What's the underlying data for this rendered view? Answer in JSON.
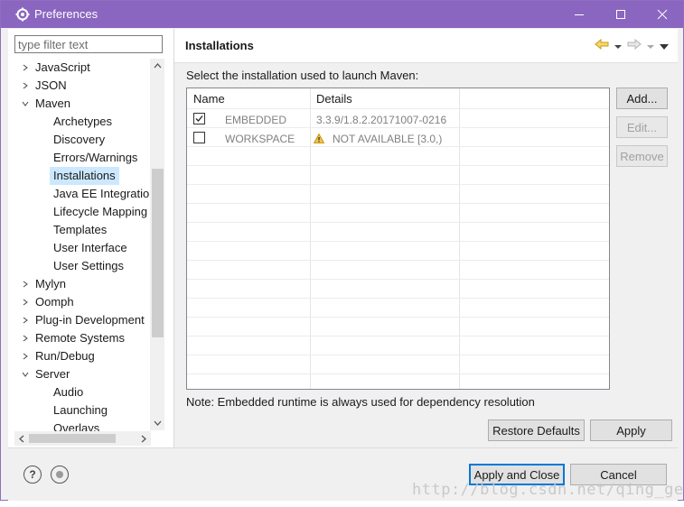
{
  "window": {
    "title": "Preferences"
  },
  "filter": {
    "placeholder": "type filter text"
  },
  "tree": {
    "items": [
      {
        "label": "JavaScript",
        "expanded": false
      },
      {
        "label": "JSON",
        "expanded": false
      },
      {
        "label": "Maven",
        "expanded": true
      },
      {
        "label": "Archetypes"
      },
      {
        "label": "Discovery"
      },
      {
        "label": "Errors/Warnings"
      },
      {
        "label": "Installations",
        "selected": true
      },
      {
        "label": "Java EE Integration"
      },
      {
        "label": "Lifecycle Mapping"
      },
      {
        "label": "Templates"
      },
      {
        "label": "User Interface"
      },
      {
        "label": "User Settings"
      },
      {
        "label": "Mylyn",
        "expanded": false
      },
      {
        "label": "Oomph",
        "expanded": false
      },
      {
        "label": "Plug-in Development",
        "expanded": false
      },
      {
        "label": "Remote Systems",
        "expanded": false
      },
      {
        "label": "Run/Debug",
        "expanded": false
      },
      {
        "label": "Server",
        "expanded": true
      },
      {
        "label": "Audio"
      },
      {
        "label": "Launching"
      },
      {
        "label": "Overlays"
      }
    ]
  },
  "page": {
    "title": "Installations",
    "prompt": "Select the installation used to launch Maven:",
    "note": "Note: Embedded runtime is always used for dependency resolution"
  },
  "table": {
    "columns": [
      "Name",
      "Details"
    ],
    "rows": [
      {
        "checked": true,
        "name": "EMBEDDED",
        "details": "3.3.9/1.8.2.20171007-0216",
        "warning": false
      },
      {
        "checked": false,
        "name": "WORKSPACE",
        "details": "NOT AVAILABLE [3.0,)",
        "warning": true
      }
    ]
  },
  "buttons": {
    "add": "Add...",
    "edit": "Edit...",
    "remove": "Remove",
    "restore_defaults": "Restore Defaults",
    "apply": "Apply",
    "apply_and_close": "Apply and Close",
    "cancel": "Cancel"
  },
  "watermark": "http://blog.csdn.net/qing_gee",
  "colors": {
    "titlebar": "#8a66c0",
    "selection": "#cce8ff",
    "default_button_border": "#0078d7"
  }
}
